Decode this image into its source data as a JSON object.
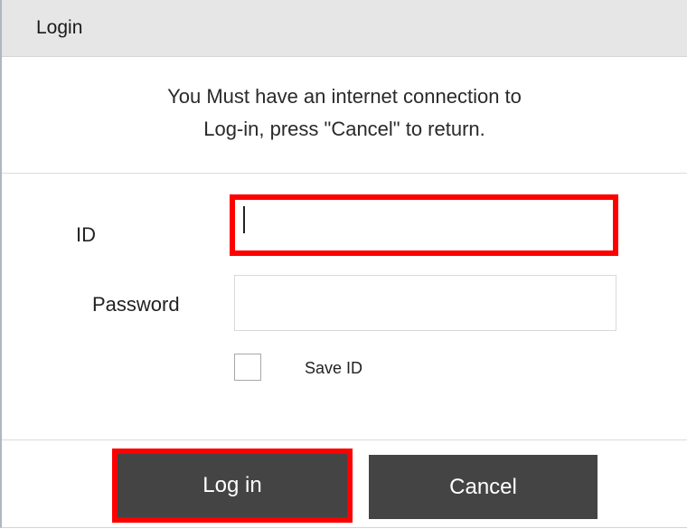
{
  "window": {
    "title": "Login"
  },
  "message": {
    "line1": "You Must have an internet connection to",
    "line2": "Log-in, press \"Cancel\" to return."
  },
  "form": {
    "id_label": "ID",
    "id_value": "",
    "password_label": "Password",
    "password_value": "",
    "save_id_label": "Save ID",
    "save_id_checked": false
  },
  "buttons": {
    "login_label": "Log in",
    "cancel_label": "Cancel"
  },
  "colors": {
    "highlight": "#ff0000",
    "button_bg": "#444444",
    "titlebar_bg": "#e6e6e6"
  }
}
